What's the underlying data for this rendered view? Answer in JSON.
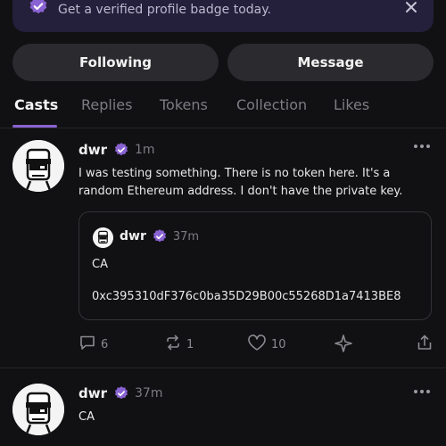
{
  "banner": {
    "text": "Get a verified profile badge today."
  },
  "actions": {
    "following_label": "Following",
    "message_label": "Message"
  },
  "tabs": [
    {
      "label": "Casts",
      "active": true
    },
    {
      "label": "Replies",
      "active": false
    },
    {
      "label": "Tokens",
      "active": false
    },
    {
      "label": "Collection",
      "active": false
    },
    {
      "label": "Likes",
      "active": false
    }
  ],
  "casts": [
    {
      "author": "dwr",
      "time": "1m",
      "text": "I was testing something. There is no token here. It's a random Ethereum address. I don't have the private key.",
      "quote": {
        "author": "dwr",
        "time": "37m",
        "line1": "CA",
        "line2": "0xc395310dF376c0ba35D29B00c55268D1a7413BE8"
      },
      "replies": "6",
      "recasts": "1",
      "likes": "10"
    },
    {
      "author": "dwr",
      "time": "37m",
      "text": "CA"
    }
  ],
  "colors": {
    "accent": "#8a63d2",
    "background": "#111113",
    "pill": "#2b2b2f",
    "banner": "#241f3a"
  },
  "icons": [
    "verified-badge-icon",
    "close-icon",
    "more-icon",
    "reply-icon",
    "recast-icon",
    "like-icon",
    "tip-icon",
    "share-icon"
  ]
}
